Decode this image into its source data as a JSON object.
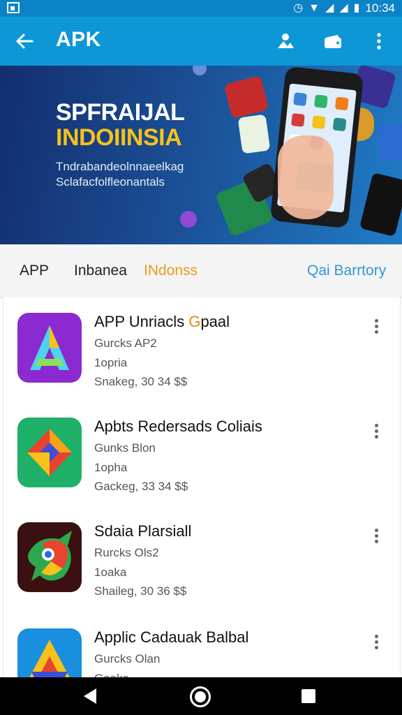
{
  "status_bar": {
    "time": "10:34"
  },
  "app_bar": {
    "title": "APK"
  },
  "banner": {
    "headline_1": "SPFRAIJAL",
    "headline_2": "INDOIINSIA",
    "subline_1": "Tndrabandeolnnaeelkag",
    "subline_2": "Sclafacfolfleonantals",
    "accent": "#f6c21a"
  },
  "tabs": {
    "tab1": "APP",
    "tab2": "Inbanea",
    "tab3": "INdonss",
    "link": "Qai Barrtory",
    "active_color": "#ef9a1a",
    "link_color": "#2e9ad4"
  },
  "apps": [
    {
      "name_main": "APP Unriacls ",
      "name_hl": "G",
      "name_tail": "paal",
      "line1": "Gurcks AP2",
      "line2": "1opria",
      "line3": "Snakeg,  30   34  $$",
      "icon": "letter-a-icon"
    },
    {
      "name_main": "Apbts Redersads Coliais",
      "name_hl": "",
      "name_tail": "",
      "line1": "Gunks Blon",
      "line2": "1opha",
      "line3": "Gackeg,  33   34  $$",
      "icon": "diamond-icon"
    },
    {
      "name_main": "Sdaia Plarsiall",
      "name_hl": "",
      "name_tail": "",
      "line1": "Rurcks Ols2",
      "line2": "1oaka",
      "line3": "Shaileg,  30   36  $$",
      "icon": "bird-icon"
    },
    {
      "name_main": "Applic Cadauak Balbal",
      "name_hl": "",
      "name_tail": "",
      "line1": "Gurcks Olan",
      "line2": "Gaaka",
      "line3": "",
      "icon": "triangle-icon"
    }
  ]
}
